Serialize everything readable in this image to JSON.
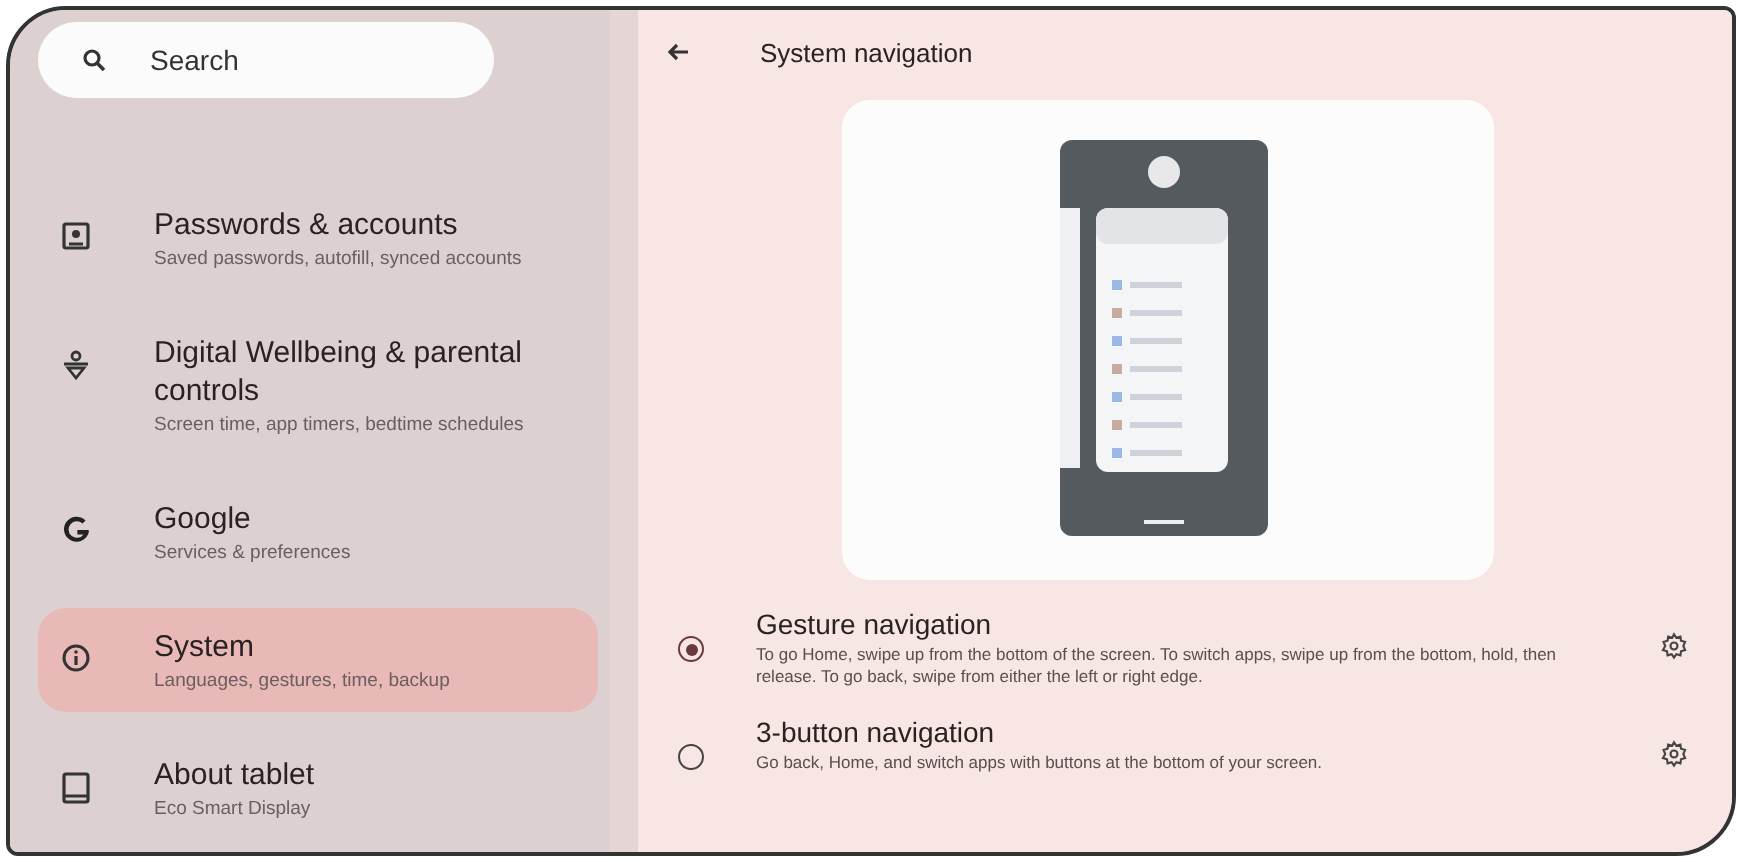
{
  "search": {
    "placeholder": "Search"
  },
  "sidebar": {
    "items": [
      {
        "kind": "account",
        "title": "Passwords & accounts",
        "subtitle": "Saved passwords, autofill, synced accounts",
        "selected": false
      },
      {
        "kind": "wellbeing",
        "title": "Digital Wellbeing & parental controls",
        "subtitle": "Screen time, app timers, bedtime schedules",
        "selected": false
      },
      {
        "kind": "google",
        "title": "Google",
        "subtitle": "Services & preferences",
        "selected": false
      },
      {
        "kind": "info",
        "title": "System",
        "subtitle": "Languages, gestures, time, backup",
        "selected": true
      },
      {
        "kind": "tablet",
        "title": "About tablet",
        "subtitle": "Eco Smart Display",
        "selected": false
      }
    ]
  },
  "header": {
    "title": "System navigation"
  },
  "options": [
    {
      "title": "Gesture navigation",
      "description": "To go Home, swipe up from the bottom of the screen. To switch apps, swipe up from the bottom, hold, then release. To go back, swipe from either the left or right edge.",
      "selected": true
    },
    {
      "title": "3-button navigation",
      "description": "Go back, Home, and switch apps with buttons at the bottom of your screen.",
      "selected": false
    }
  ]
}
